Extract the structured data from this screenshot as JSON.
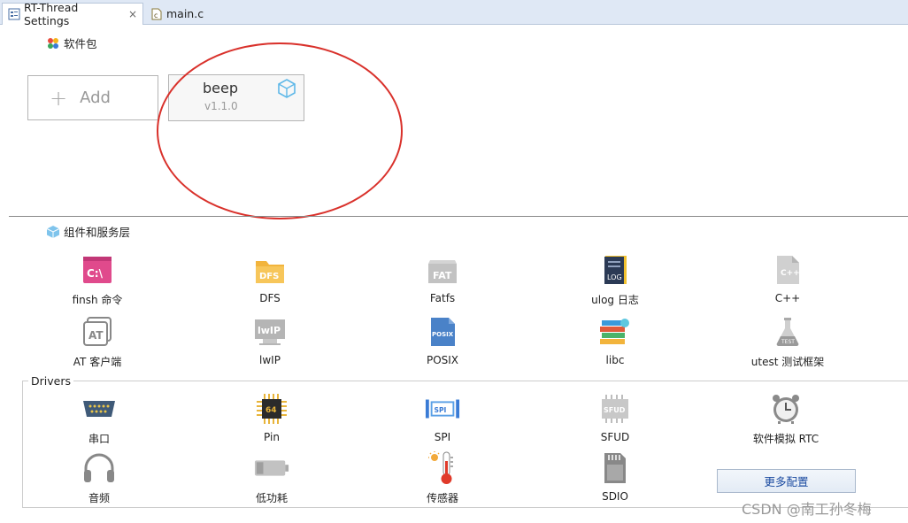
{
  "tabs": [
    {
      "label": "RT-Thread Settings",
      "close": "×"
    },
    {
      "label": "main.c"
    }
  ],
  "packages": {
    "title": "软件包",
    "add_label": "Add",
    "items": [
      {
        "name": "beep",
        "version": "v1.1.0"
      }
    ]
  },
  "components": {
    "title": "组件和服务层",
    "items": [
      {
        "label": "finsh 命令",
        "icon": "terminal-icon",
        "icon_text": "C:\\"
      },
      {
        "label": "DFS",
        "icon": "folder-icon",
        "icon_text": "DFS"
      },
      {
        "label": "Fatfs",
        "icon": "fat-drive-icon",
        "icon_text": "FAT"
      },
      {
        "label": "ulog 日志",
        "icon": "log-book-icon",
        "icon_text": "LOG"
      },
      {
        "label": "C++",
        "icon": "cpp-file-icon",
        "icon_text": "C++"
      },
      {
        "label": "AT 客户端",
        "icon": "at-icon",
        "icon_text": "AT"
      },
      {
        "label": "lwIP",
        "icon": "lwip-icon",
        "icon_text": "lwIP"
      },
      {
        "label": "POSIX",
        "icon": "posix-file-icon",
        "icon_text": "POSIX"
      },
      {
        "label": "libc",
        "icon": "books-icon"
      },
      {
        "label": "utest 测试框架",
        "icon": "flask-icon",
        "icon_text": "TEST"
      }
    ]
  },
  "drivers": {
    "title": "Drivers",
    "items": [
      {
        "label": "串口",
        "icon": "serial-port-icon"
      },
      {
        "label": "Pin",
        "icon": "chip-icon",
        "icon_text": "64"
      },
      {
        "label": "SPI",
        "icon": "spi-icon",
        "icon_text": "SPI"
      },
      {
        "label": "SFUD",
        "icon": "sfud-chip-icon",
        "icon_text": "SFUD"
      },
      {
        "label": "软件模拟 RTC",
        "icon": "alarm-clock-icon"
      },
      {
        "label": "音频",
        "icon": "headphones-icon"
      },
      {
        "label": "低功耗",
        "icon": "battery-icon"
      },
      {
        "label": "传感器",
        "icon": "thermometer-icon"
      },
      {
        "label": "SDIO",
        "icon": "sd-card-icon"
      }
    ],
    "more_button": "更多配置"
  },
  "watermark": "CSDN @南工孙冬梅",
  "colors": {
    "annotation": "#d9312b",
    "accent": "#1a4aa0"
  }
}
